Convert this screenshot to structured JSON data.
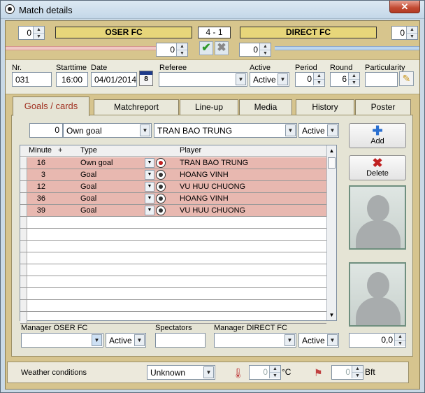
{
  "window": {
    "title": "Match details",
    "close_glyph": "✕"
  },
  "match": {
    "home_team": "OSER FC",
    "away_team": "DIRECT FC",
    "score": "4  -  1",
    "home_spin_top": "0",
    "away_spin_top": "0",
    "home_spin_mid": "0",
    "away_spin_mid": "0"
  },
  "info": {
    "nr_label": "Nr.",
    "nr_value": "031",
    "starttime_label": "Starttime",
    "starttime_value": "16:00",
    "date_label": "Date",
    "date_value": "04/01/2014",
    "referee_label": "Referee",
    "referee_value": "",
    "active_label": "Active",
    "active_value": "Active",
    "period_label": "Period",
    "period_value": "0",
    "round_label": "Round",
    "round_value": "6",
    "particularity_label": "Particularity",
    "particularity_value": ""
  },
  "tabs": [
    "Goals / cards",
    "Matchreport",
    "Line-up",
    "Media",
    "History",
    "Poster"
  ],
  "goal_editor": {
    "minute": "0",
    "type": "Own goal",
    "player": "TRAN BAO TRUNG",
    "status": "Active"
  },
  "grid": {
    "headers": {
      "minute": "Minute",
      "plus": "+",
      "type": "Type",
      "player": "Player"
    },
    "rows": [
      {
        "minute": "16",
        "type": "Own goal",
        "player": "TRAN BAO TRUNG"
      },
      {
        "minute": "3",
        "type": "Goal",
        "player": "HOANG VINH"
      },
      {
        "minute": "12",
        "type": "Goal",
        "player": "VU HUU CHUONG"
      },
      {
        "minute": "36",
        "type": "Goal",
        "player": "HOANG VINH"
      },
      {
        "minute": "39",
        "type": "Goal",
        "player": "VU HUU CHUONG"
      }
    ]
  },
  "buttons": {
    "add": "Add",
    "delete": "Delete"
  },
  "managers": {
    "home_label": "Manager OSER FC",
    "home_value": "",
    "home_status": "Active",
    "spectators_label": "Spectators",
    "spectators_value": "",
    "away_label": "Manager DIRECT FC",
    "away_value": "",
    "away_status": "Active",
    "rating_value": "0,0"
  },
  "weather": {
    "label": "Weather conditions",
    "value": "Unknown",
    "temp_value": "0",
    "temp_unit": "°C",
    "wind_value": "0",
    "wind_unit": "Bft"
  },
  "colors": {
    "home_bar": "#f0c8c4",
    "away_bar": "#bcd6ee",
    "active_tab_text": "#a03020",
    "filled_row": "#e8b8b0"
  }
}
